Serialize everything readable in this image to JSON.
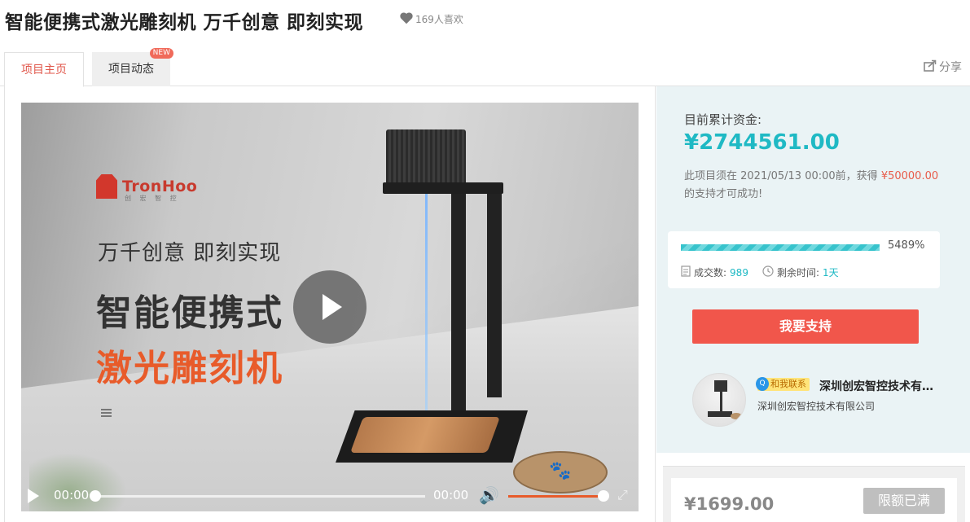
{
  "header": {
    "title": "智能便携式激光雕刻机 万千创意 即刻实现",
    "likes_label": "169人喜欢"
  },
  "tabs": [
    {
      "label": "项目主页",
      "active": true
    },
    {
      "label": "项目动态",
      "badge": "NEW"
    }
  ],
  "share_label": "分享",
  "video": {
    "brand": "TronHoo",
    "brand_sub": "创 宏 智 控",
    "slogan": "万千创意  即刻实现",
    "headline_1": "智能便携式",
    "headline_2": "激光雕刻机",
    "current_time": "00:00",
    "duration": "00:00",
    "progress": 0,
    "volume": 1.0
  },
  "funding": {
    "raised_label": "目前累计资金:",
    "raised_amount": "¥2744561.00",
    "deadline_prefix": "此项目须在 2021/05/13 00:00前，获得",
    "goal_amount": "¥50000.00",
    "deadline_suffix": "的支持才可成功!",
    "percent": "5489%",
    "percent_value": 54.89,
    "deals_label": "成交数:",
    "deals_value": "989",
    "remaining_label": "剩余时间:",
    "remaining_value": "1天",
    "support_button": "我要支持"
  },
  "sponsor": {
    "contact_label": "和我联系",
    "contact_icon": "qq-icon",
    "name_short": "深圳创宏智控技术有限公司",
    "name_full": "深圳创宏智控技术有限公司"
  },
  "tier": {
    "price": "¥1699.00",
    "button": "限额已满"
  },
  "colors": {
    "accent_teal": "#1fb9c4",
    "accent_red": "#f1564b",
    "orange": "#e85b2a"
  }
}
